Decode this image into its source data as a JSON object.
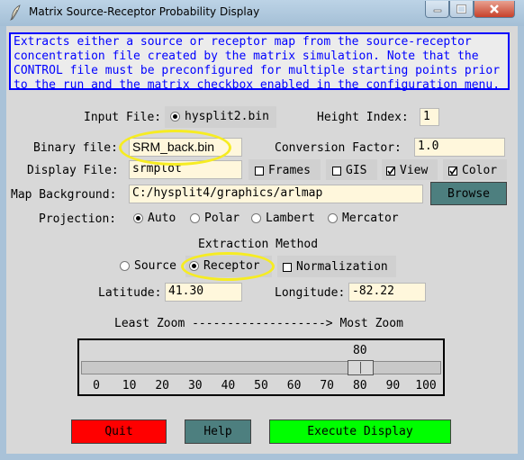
{
  "window": {
    "title": "Matrix Source-Receptor Probability Display",
    "icon": "feather-pen-icon",
    "controls": [
      "minimize-icon",
      "maximize-icon",
      "close-icon"
    ]
  },
  "description": [
    "Extracts either a source or receptor map from the source-receptor",
    "concentration file created by the matrix simulation. Note that the",
    "CONTROL file must be preconfigured for multiple starting points prior",
    "to the run and the matrix checkbox enabled in the configuration menu."
  ],
  "input_file": {
    "label": "Input File:",
    "value": "hysplit2.bin",
    "selected": true
  },
  "height_index": {
    "label": "Height Index:",
    "value": "1"
  },
  "binary_file": {
    "label": "Binary file:",
    "value": "SRM_back.bin"
  },
  "conversion_factor": {
    "label": "Conversion Factor:",
    "value": "1.0"
  },
  "display_file": {
    "label": "Display File:",
    "value": "srmplot"
  },
  "checkboxes": {
    "frames": {
      "label": "Frames",
      "checked": false
    },
    "gis": {
      "label": "GIS",
      "checked": false
    },
    "view": {
      "label": "View",
      "checked": true
    },
    "color": {
      "label": "Color",
      "checked": true
    }
  },
  "map_background": {
    "label": "Map Background:",
    "value": "C:/hysplit4/graphics/arlmap",
    "browse": "Browse"
  },
  "projection": {
    "label": "Projection:",
    "options": [
      "Auto",
      "Polar",
      "Lambert",
      "Mercator"
    ],
    "selected": "Auto"
  },
  "extraction": {
    "heading": "Extraction Method",
    "source": "Source",
    "receptor": "Receptor",
    "selected": "Receptor",
    "normalization": {
      "label": "Normalization",
      "checked": false
    }
  },
  "latitude": {
    "label": "Latitude:",
    "value": "41.30"
  },
  "longitude": {
    "label": "Longitude:",
    "value": "-82.22"
  },
  "zoom": {
    "caption": "Least Zoom -------------------> Most Zoom",
    "value": 80,
    "value_text": "80",
    "min": 0,
    "max": 100,
    "ticks": [
      "0",
      "10",
      "20",
      "30",
      "40",
      "50",
      "60",
      "70",
      "80",
      "90",
      "100"
    ]
  },
  "buttons": {
    "quit": "Quit",
    "help": "Help",
    "execute": "Execute Display"
  },
  "colors": {
    "description_text": "#0000ff",
    "entry_bg": "#fff7dc",
    "browse_bg": "#4d7f7f",
    "quit_bg": "#ff0000",
    "help_bg": "#4d7f7f",
    "execute_bg": "#00ff00",
    "highlight": "#f6ec22"
  }
}
